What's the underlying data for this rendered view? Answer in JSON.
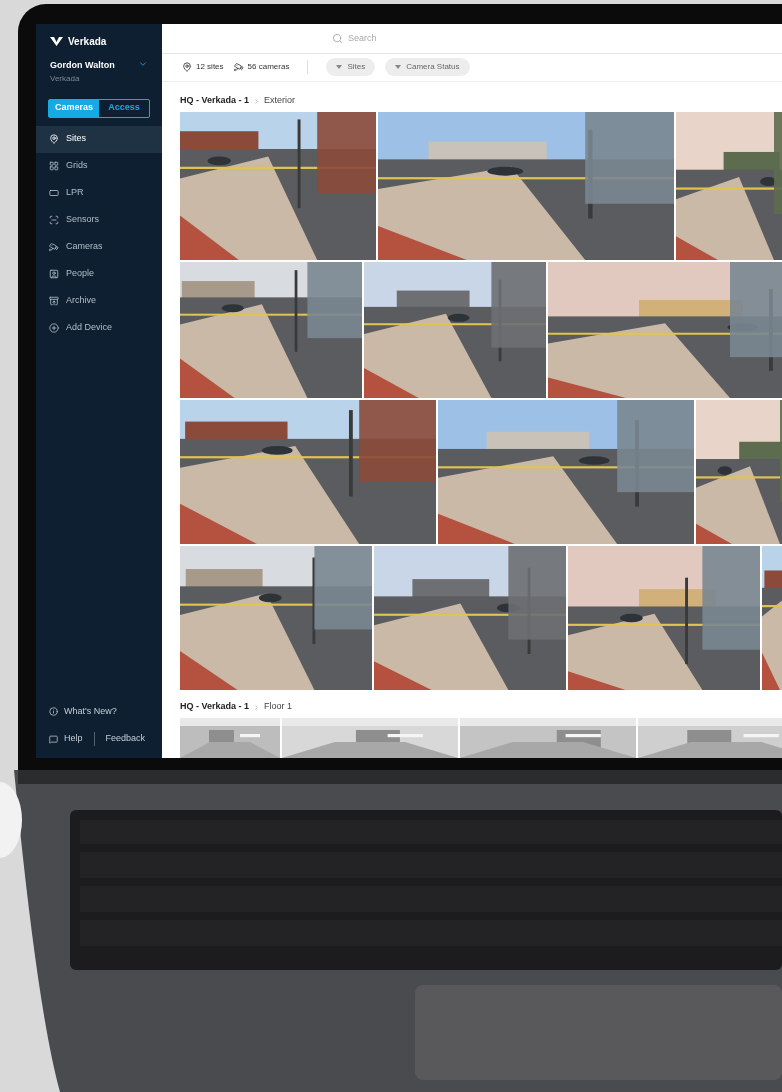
{
  "sidebar": {
    "brand": "Verkada",
    "user": {
      "name": "Gordon Walton",
      "org": "Verkada"
    },
    "toggle": [
      {
        "label": "Cameras",
        "selected": true
      },
      {
        "label": "Access",
        "selected": false
      }
    ],
    "items": [
      {
        "label": "Sites",
        "selected": true
      },
      {
        "label": "Grids",
        "selected": false
      },
      {
        "label": "LPR",
        "selected": false
      },
      {
        "label": "Sensors",
        "selected": false
      },
      {
        "label": "Cameras",
        "selected": false
      },
      {
        "label": "People",
        "selected": false
      },
      {
        "label": "Archive",
        "selected": false
      },
      {
        "label": "Add Device",
        "selected": false
      }
    ],
    "whats_new": "What's New?",
    "help": "Help",
    "feedback": "Feedback"
  },
  "search": {
    "placeholder": "Search"
  },
  "stats": {
    "sites": "12 sites",
    "cameras": "56 cameras"
  },
  "filters": [
    "Sites",
    "Camera Status"
  ],
  "sections": [
    {
      "site": "HQ - Verkada - 1",
      "area": "Exterior"
    },
    {
      "site": "HQ - Verkada - 1",
      "area": "Floor 1"
    }
  ]
}
